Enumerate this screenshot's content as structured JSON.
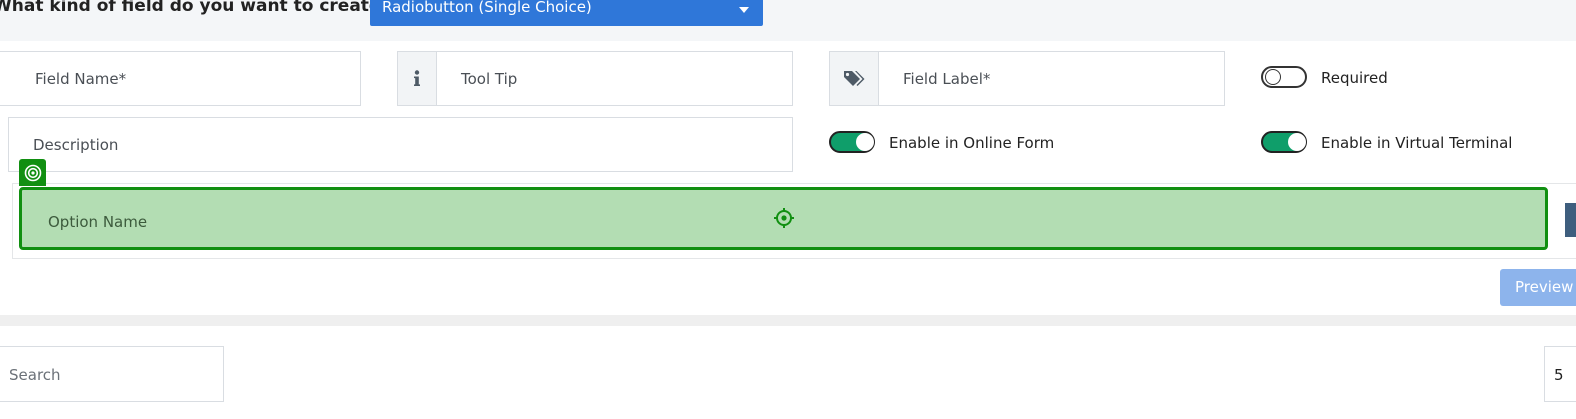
{
  "header": {
    "question": "What kind of field do you want to create?",
    "field_type_selected": "Radiobutton (Single Choice)"
  },
  "form": {
    "field_name_placeholder": "Field Name*",
    "tooltip_placeholder": "Tool Tip",
    "field_label_placeholder": "Field Label*",
    "description_placeholder": "Description",
    "required_label": "Required",
    "required_on": false,
    "enable_online_label": "Enable in Online Form",
    "enable_online_on": true,
    "enable_terminal_label": "Enable in Virtual Terminal",
    "enable_terminal_on": true
  },
  "options": {
    "option_name_placeholder": "Option Name"
  },
  "actions": {
    "preview_label": "Preview"
  },
  "table_controls": {
    "search_placeholder": "Search",
    "page_size": "5"
  },
  "icons": {
    "tooltip": "info-icon",
    "label": "tag-icon",
    "handle": "target-icon",
    "crosshair": "crosshair-icon",
    "select_caret": "caret-down-icon"
  },
  "colors": {
    "primary": "#2f77d9",
    "toggle_on": "#0f9e6a",
    "option_bg": "#b3ddb3",
    "option_border": "#118f11",
    "preview_btn": "#8db4ec"
  }
}
